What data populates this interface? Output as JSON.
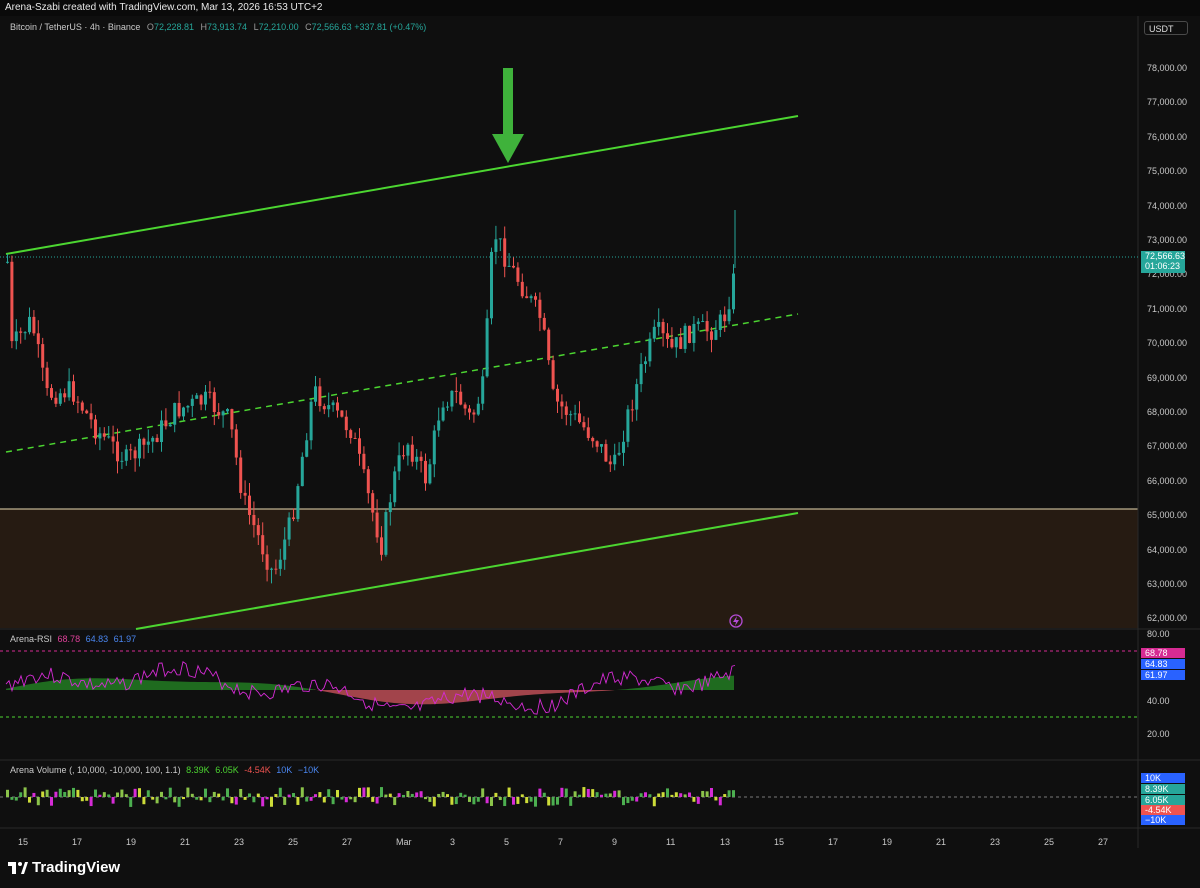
{
  "header": {
    "credit": "Arena-Szabi created with TradingView.com, Mar 13, 2026 16:53 UTC+2",
    "symbol": "Bitcoin / TetherUS · 4h · Binance",
    "ohlc": [
      {
        "key": "O",
        "value": "72,228.81"
      },
      {
        "key": "H",
        "value": "73,913.74"
      },
      {
        "key": "L",
        "value": "72,210.00"
      },
      {
        "key": "C",
        "value": "72,566.63"
      }
    ],
    "change": "+337.81 (+0.47%)",
    "currency_button": "USDT"
  },
  "price_axis": {
    "labels": [
      "78,000.00",
      "77,000.00",
      "76,000.00",
      "75,000.00",
      "74,000.00",
      "73,000.00",
      "72,000.00",
      "71,000.00",
      "70,000.00",
      "69,000.00",
      "68,000.00",
      "67,000.00",
      "66,000.00",
      "65,000.00",
      "64,000.00",
      "63,000.00",
      "62,000.00"
    ],
    "current_price": "72,566.63",
    "countdown": "01:06:23"
  },
  "rsi_pane": {
    "name": "Arena-RSI",
    "values": [
      "68.78",
      "64.83",
      "61.97"
    ],
    "axis": [
      "80.00",
      "40.00",
      "20.00"
    ],
    "tags": [
      "68.78",
      "64.83",
      "61.97"
    ]
  },
  "volume_pane": {
    "name": "Arena Volume",
    "params": "(, 10,000, -10,000, 100, 1.1)",
    "values": [
      "8.39K",
      "6.05K",
      "-4.54K",
      "10K",
      "−10K"
    ],
    "tags": [
      "10K",
      "8.39K",
      "6.05K",
      "-4.54K",
      "−10K"
    ]
  },
  "time_axis": [
    "15",
    "17",
    "19",
    "21",
    "23",
    "25",
    "27",
    "Mar",
    "3",
    "5",
    "7",
    "9",
    "11",
    "13",
    "15",
    "17",
    "19",
    "21",
    "23",
    "25",
    "27"
  ],
  "footer": {
    "logo": "TradingView"
  },
  "colors": {
    "bull": "#26a69a",
    "bear": "#ef5350",
    "channel": "#4cd631",
    "zone": "#2a1e14",
    "rsi_line": "#d62bd6",
    "rsi_pos": "#1f6b1f",
    "rsi_neg": "#a2444b"
  }
}
